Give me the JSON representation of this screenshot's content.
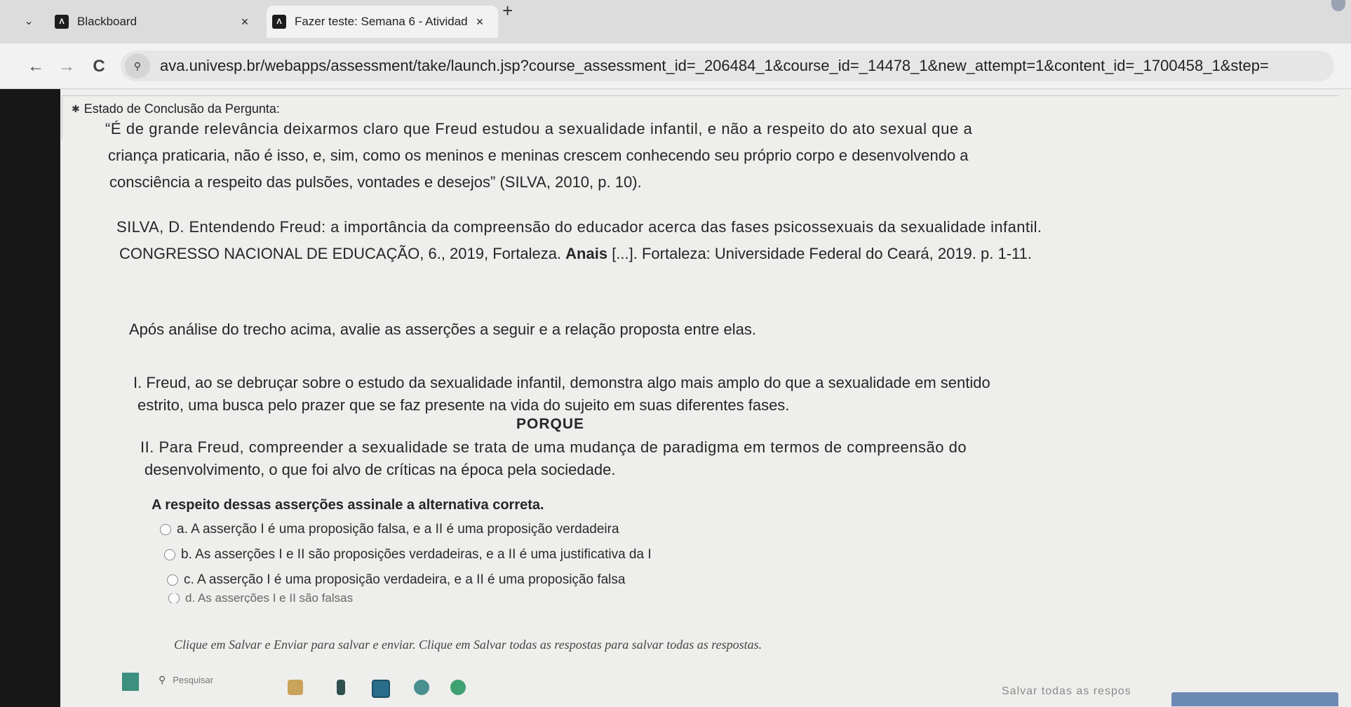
{
  "browser": {
    "tabs": [
      {
        "title": "Blackboard",
        "favicon": "blackboard-logo",
        "close": "×"
      },
      {
        "title": "Fazer teste: Semana 6 - Atividad",
        "favicon": "blackboard-logo",
        "close": "×"
      }
    ],
    "favicon_glyph": "Λ",
    "new_tab": "+",
    "nav": {
      "back": "←",
      "forward": "→",
      "reload": "C"
    },
    "site_info_glyph": "⚲",
    "url": "ava.univesp.br/webapps/assessment/take/launch.jsp?course_assessment_id=_206484_1&course_id=_14478_1&new_attempt=1&content_id=_1700458_1&step="
  },
  "question": {
    "status_label": "Estado de Conclusão da Pergunta:",
    "quote_lines": [
      "“É de grande relevância deixarmos claro que Freud estudou a sexualidade infantil, e não a respeito do ato sexual que a",
      "criança praticaria, não é isso, e, sim, como os meninos e meninas crescem conhecendo seu próprio corpo e desenvolvendo a",
      "consciência a respeito das pulsões, vontades e desejos” (SILVA, 2010, p. 10)."
    ],
    "reference": {
      "line1": "SILVA, D. Entendendo Freud: a importância da compreensão do educador acerca das fases psicossexuais da sexualidade infantil.",
      "line2_pre": "CONGRESSO NACIONAL DE EDUCAÇÃO, 6., 2019, Fortaleza. ",
      "line2_bold": "Anais",
      "line2_post": " [...]. Fortaleza: Universidade Federal do Ceará, 2019. p. 1-11."
    },
    "intro": "Após análise do trecho acima, avalie as asserções a seguir e a relação proposta entre elas.",
    "assertion1_lines": [
      "I. Freud, ao se debruçar sobre o estudo da sexualidade infantil, demonstra algo mais amplo do que a sexualidade em sentido",
      "estrito, uma busca pelo prazer que se faz presente na vida do sujeito em suas diferentes fases."
    ],
    "porque": "PORQUE",
    "assertion2_lines": [
      "II. Para Freud, compreender a sexualidade se trata de uma mudança de paradigma em termos de compreensão do",
      "desenvolvimento, o que foi alvo de críticas na época pela sociedade."
    ],
    "instruction": "A respeito dessas asserções assinale a alternativa correta.",
    "options": [
      "a. A asserção I é uma proposição falsa, e a II é uma proposição verdadeira",
      "b. As asserções I e II são proposições verdadeiras, e a II é uma justificativa da I",
      "c. A asserção I é uma proposição verdadeira, e a II é uma proposição falsa",
      "d. As asserções I e II são falsas"
    ]
  },
  "footer": {
    "save_hint": "Clique em Salvar e Enviar para salvar e enviar. Clique em Salvar todas as respostas para salvar todas as respostas.",
    "save_all": "Salvar todas as respos"
  },
  "taskbar": {
    "search_placeholder": "Pesquisar"
  },
  "colors": {
    "page_bg": "#eeeeec",
    "chrome_bg": "#dcdcdc",
    "save_button": "#6d89b5"
  }
}
